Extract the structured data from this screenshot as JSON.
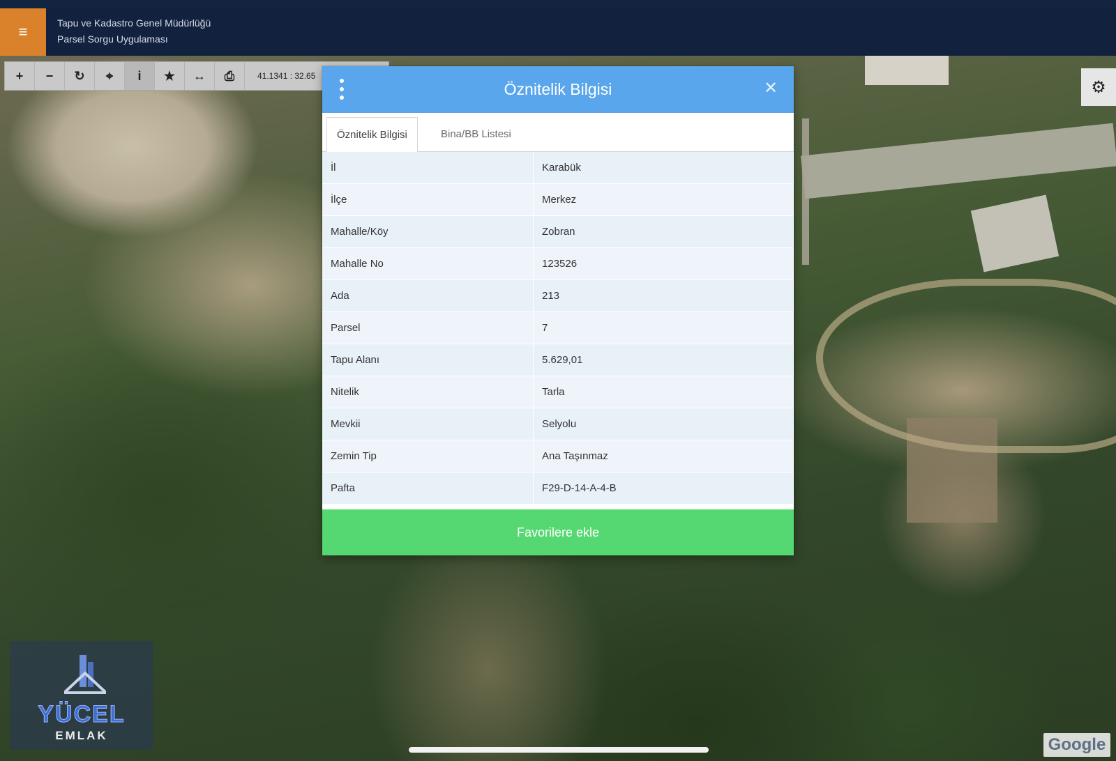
{
  "header": {
    "menu_icon": "hamburger-icon",
    "title_line1": "Tapu ve Kadastro Genel Müdürlüğü",
    "title_line2": "Parsel Sorgu Uygulaması"
  },
  "toolbar": {
    "tools": [
      {
        "name": "zoom-in-icon",
        "glyph": "+"
      },
      {
        "name": "zoom-out-icon",
        "glyph": "−"
      },
      {
        "name": "refresh-icon",
        "glyph": "↻"
      },
      {
        "name": "locate-icon",
        "glyph": "⌖"
      },
      {
        "name": "info-icon",
        "glyph": "i"
      },
      {
        "name": "star-icon",
        "glyph": "★"
      },
      {
        "name": "measure-icon",
        "glyph": "↔"
      },
      {
        "name": "print-icon",
        "glyph": "⎙"
      }
    ],
    "coordinates": "41.1341 : 32.65"
  },
  "settings_icon": "gear-icon",
  "dialog": {
    "title": "Öznitelik Bilgisi",
    "menu_icon": "kebab-menu-icon",
    "close_icon": "close-icon",
    "tabs": [
      {
        "label": "Öznitelik Bilgisi",
        "active": true
      },
      {
        "label": "Bina/BB Listesi",
        "active": false
      }
    ],
    "rows": [
      {
        "key": "İl",
        "value": "Karabük"
      },
      {
        "key": "İlçe",
        "value": "Merkez"
      },
      {
        "key": "Mahalle/Köy",
        "value": "Zobran"
      },
      {
        "key": "Mahalle No",
        "value": "123526"
      },
      {
        "key": "Ada",
        "value": "213"
      },
      {
        "key": "Parsel",
        "value": "7"
      },
      {
        "key": "Tapu Alanı",
        "value": "5.629,01"
      },
      {
        "key": "Nitelik",
        "value": "Tarla"
      },
      {
        "key": "Mevkii",
        "value": "Selyolu"
      },
      {
        "key": "Zemin Tip",
        "value": "Ana Taşınmaz"
      },
      {
        "key": "Pafta",
        "value": "F29-D-14-A-4-B"
      }
    ],
    "favorite_button": "Favorilere ekle"
  },
  "watermark_logo": {
    "line1": "YÜCEL",
    "line2": "EMLAK"
  },
  "map_attribution": "Google",
  "colors": {
    "header_bg": "#12223e",
    "menu_button": "#d9822b",
    "dialog_header": "#5aa6ec",
    "favorite_button": "#55d871"
  }
}
